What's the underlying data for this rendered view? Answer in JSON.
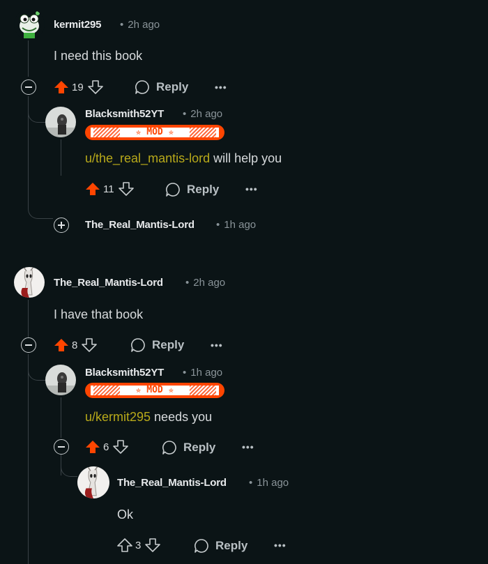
{
  "colors": {
    "background": "#0b1416",
    "upvote": "#ff4500",
    "mention": "#b8a91a",
    "flair": "#ff4500"
  },
  "thread1": {
    "comment": {
      "user": "kermit295",
      "time": "2h ago",
      "body": "I need this book",
      "votes": "19",
      "reply_label": "Reply",
      "more": "•••",
      "upvoted": true
    },
    "reply1": {
      "user": "Blacksmith52YT",
      "time": "2h ago",
      "flair": "✮ MOD ✮",
      "mention": "u/the_real_mantis-lord",
      "body": " will help you",
      "votes": "11",
      "reply_label": "Reply",
      "more": "•••",
      "upvoted": true
    },
    "reply2_collapsed": {
      "user": "The_Real_Mantis-Lord",
      "time": "1h ago"
    }
  },
  "thread2": {
    "comment": {
      "user": "The_Real_Mantis-Lord",
      "time": "2h ago",
      "body": "I have that book",
      "votes": "8",
      "reply_label": "Reply",
      "more": "•••",
      "upvoted": true
    },
    "reply1": {
      "user": "Blacksmith52YT",
      "time": "1h ago",
      "flair": "✮ MOD ✮",
      "mention": "u/kermit295",
      "body": " needs you",
      "votes": "6",
      "reply_label": "Reply",
      "more": "•••",
      "upvoted": true
    },
    "reply2": {
      "user": "The_Real_Mantis-Lord",
      "time": "1h ago",
      "body": "Ok",
      "votes": "3",
      "reply_label": "Reply",
      "more": "•••",
      "upvoted": false
    }
  }
}
